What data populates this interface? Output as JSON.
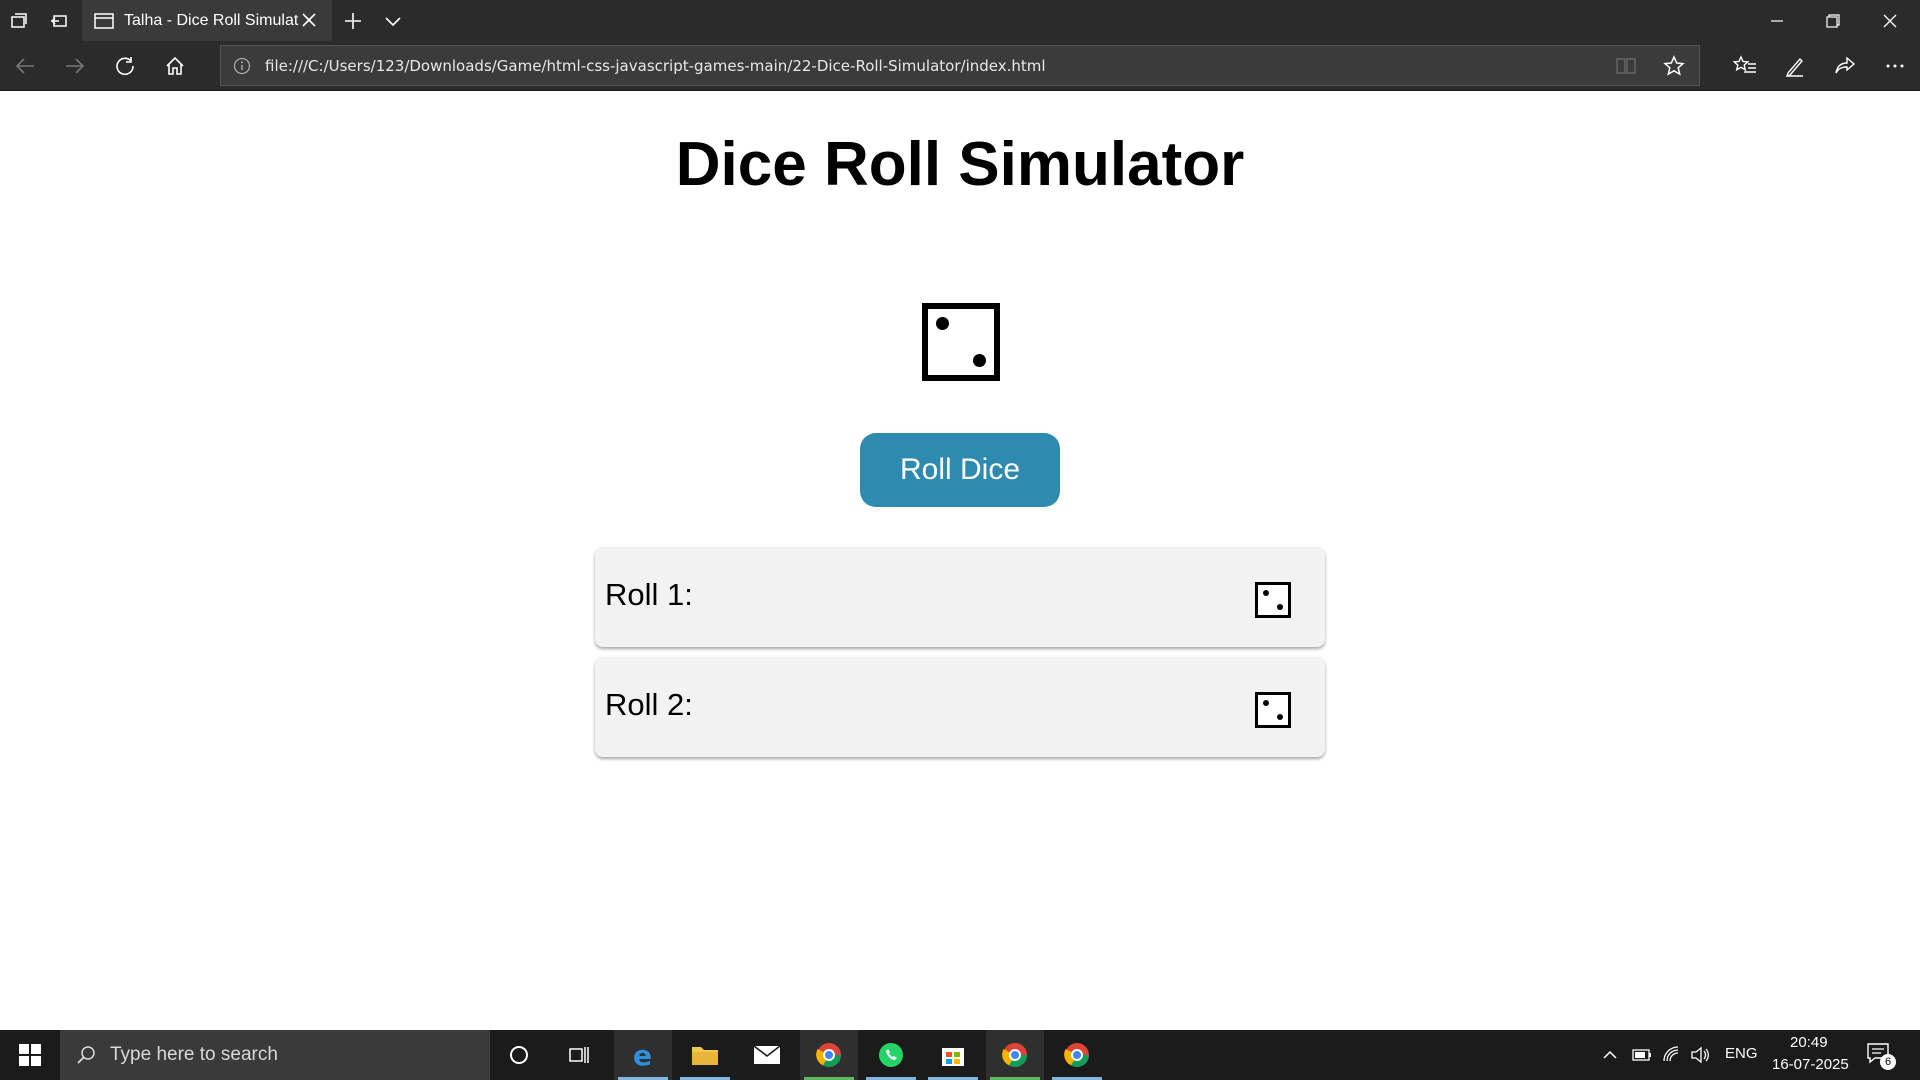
{
  "browser": {
    "tab_title": "Talha - Dice Roll Simulat",
    "address": "file:///C:/Users/123/Downloads/Game/html-css-javascript-games-main/22-Dice-Roll-Simulator/index.html"
  },
  "page": {
    "title": "Dice Roll Simulator",
    "current_die_value": 2,
    "roll_button_label": "Roll Dice",
    "history": [
      {
        "label": "Roll 1:",
        "die_value": 2
      },
      {
        "label": "Roll 2:",
        "die_value": 2
      }
    ]
  },
  "taskbar": {
    "search_placeholder": "Type here to search",
    "language": "ENG",
    "time": "20:49",
    "date": "16-07-2025",
    "notification_count": "6"
  },
  "colors": {
    "button": "#2f8ab0",
    "history_bg": "#f2f2f2"
  }
}
